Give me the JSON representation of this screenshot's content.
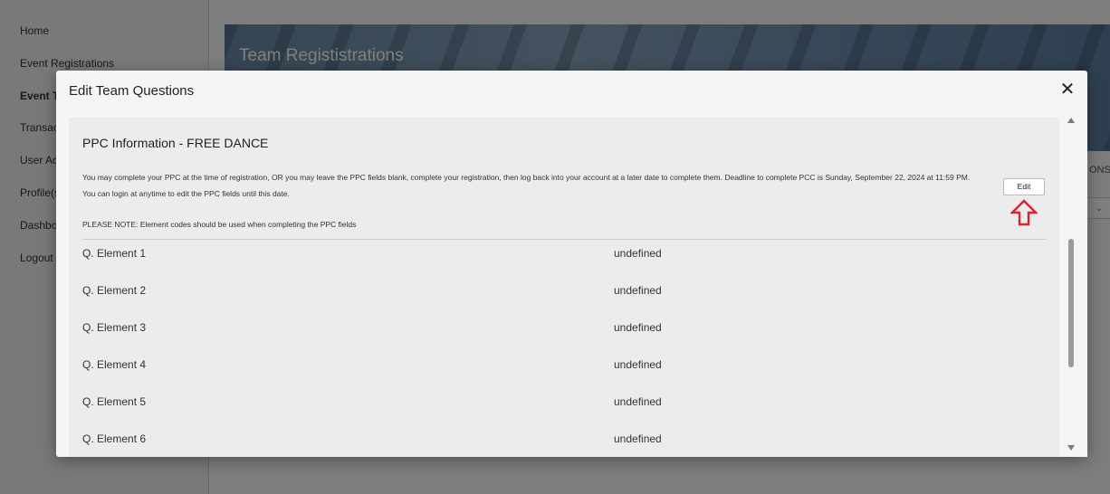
{
  "sidebar": {
    "items": [
      {
        "label": "Home"
      },
      {
        "label": "Event Registrations"
      },
      {
        "label": "Event T"
      },
      {
        "label": "Transac"
      },
      {
        "label": "User Ac"
      },
      {
        "label": "Profile(s"
      },
      {
        "label": "Dashbo"
      },
      {
        "label": "Logout"
      }
    ]
  },
  "banner": {
    "title": "Team Regististrations"
  },
  "background_fragments": {
    "ons": "ONS",
    "select_chevron": "⌄"
  },
  "modal": {
    "title": "Edit Team Questions",
    "close": "✕",
    "section_title": "PPC Information - FREE DANCE",
    "description": "You may complete your PPC at the time of registration, OR you may leave the PPC fields blank, complete your registration, then log back into your account at a later date to complete them. Deadline to complete PCC is Sunday, September 22, 2024 at 11:59 PM. You can login at anytime to edit the PPC fields until this date.",
    "note": "PLEASE NOTE: Element codes should be used when completing the PPC fields",
    "edit_label": "Edit",
    "annotation_color": "#d9232d",
    "questions": [
      {
        "label": "Q. Element 1",
        "value": "undefined"
      },
      {
        "label": "Q. Element 2",
        "value": "undefined"
      },
      {
        "label": "Q. Element 3",
        "value": "undefined"
      },
      {
        "label": "Q. Element 4",
        "value": "undefined"
      },
      {
        "label": "Q. Element 5",
        "value": "undefined"
      },
      {
        "label": "Q. Element 6",
        "value": "undefined"
      }
    ]
  }
}
